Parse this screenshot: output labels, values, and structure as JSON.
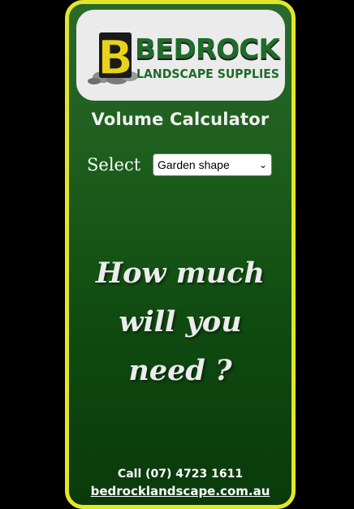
{
  "brand": {
    "logo_letter": "B",
    "logo_name": "BEDROCK",
    "logo_tagline": "LANDSCAPE SUPPLIES"
  },
  "calculator": {
    "title": "Volume Calculator",
    "select_label": "Select",
    "select_value": "Garden shape"
  },
  "headline": {
    "line1": "How much",
    "line2": "will you",
    "line3": "need ?"
  },
  "footer": {
    "phone": "Call (07) 4723 1611",
    "website": "bedrocklandscape.com.au"
  },
  "colors": {
    "frame_border": "#e4e52a",
    "panel_green": "#1b5c1b",
    "logo_green": "#1f6b2a",
    "logo_yellow": "#e8d21a"
  }
}
